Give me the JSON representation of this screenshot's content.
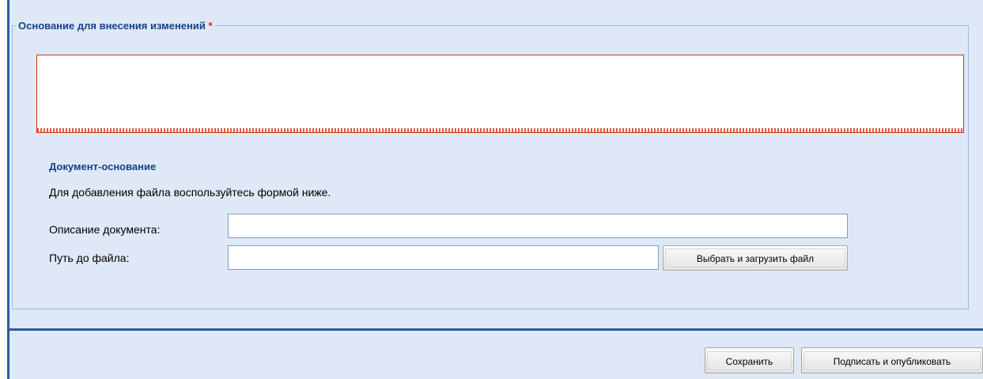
{
  "reason_section": {
    "legend": "Основание для внесения изменений",
    "required_marker": "*",
    "text_value": ""
  },
  "document_section": {
    "title": "Документ-основание",
    "hint": "Для добавления файла воспользуйтесь формой ниже.",
    "description_label": "Описание документа:",
    "description_value": "",
    "path_label": "Путь до файла:",
    "path_value": "",
    "upload_button": "Выбрать и загрузить файл"
  },
  "footer": {
    "save_button": "Сохранить",
    "sign_publish_button": "Подписать и опубликовать"
  },
  "colors": {
    "panel_background": "#dfe8f6",
    "border_accent": "#2f5aa0",
    "heading_text": "#15428b",
    "required_star": "#d8261b",
    "invalid_field_border": "#cc3300"
  }
}
